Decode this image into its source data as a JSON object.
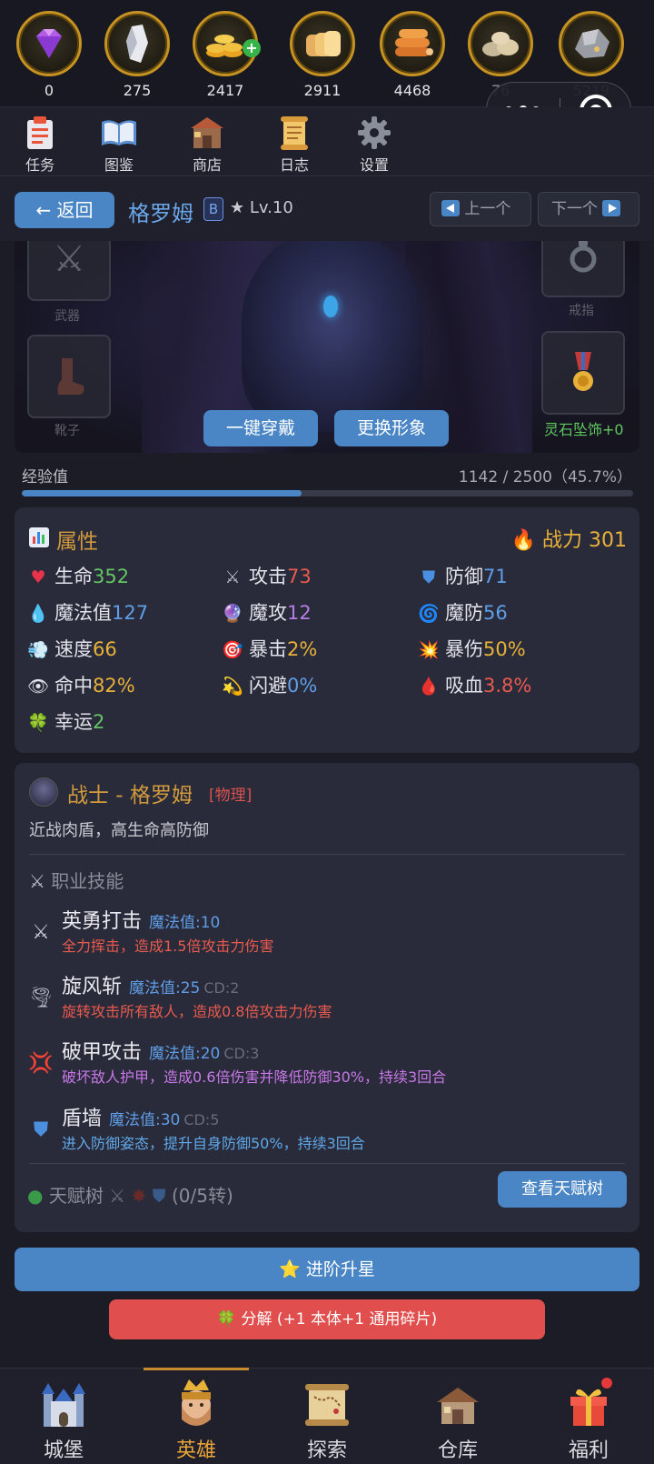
{
  "resources": [
    {
      "name": "diamond-icon",
      "value": "0"
    },
    {
      "name": "crystal-icon",
      "value": "275"
    },
    {
      "name": "gold-coins-icon",
      "value": "2417",
      "has_plus": true
    },
    {
      "name": "bread-icon",
      "value": "2911"
    },
    {
      "name": "wood-logs-icon",
      "value": "4468"
    },
    {
      "name": "stone-icon",
      "value": "76"
    },
    {
      "name": "ore-icon",
      "value": "5219"
    }
  ],
  "top_nav": [
    {
      "label": "任务",
      "icon": "clipboard-icon"
    },
    {
      "label": "图鉴",
      "icon": "book-icon"
    },
    {
      "label": "商店",
      "icon": "shop-icon"
    },
    {
      "label": "日志",
      "icon": "scroll-icon"
    },
    {
      "label": "设置",
      "icon": "gear-icon"
    }
  ],
  "header": {
    "back_label": "← 返回",
    "hero_name": "格罗姆",
    "rank": "B",
    "level": "★ Lv.10",
    "prev_label": "上一个",
    "next_label": "下一个"
  },
  "portrait": {
    "slot_weapon": "武器",
    "slot_boots": "靴子",
    "slot_ring": "戒指",
    "equip_all_label": "一键穿戴",
    "change_look_label": "更换形象",
    "lingshi_label": "灵石坠饰+0"
  },
  "exp": {
    "label": "经验值",
    "value_text": "1142 / 2500（45.7%）",
    "current": 1142,
    "max": 2500,
    "percent": 45.7
  },
  "attributes": {
    "title": "属性",
    "power_label": "战力 301",
    "stats": [
      {
        "icon": "heart-icon",
        "glyph": "♥",
        "icolor": "#e8334a",
        "label": "生命",
        "value": "352",
        "color": "#63c463"
      },
      {
        "icon": "swords-icon",
        "glyph": "⚔",
        "icolor": "#b9bcc8",
        "label": "攻击",
        "value": "73",
        "color": "#e85a4f"
      },
      {
        "icon": "shield-icon",
        "glyph": "⛊",
        "icolor": "#4a8fe0",
        "label": "防御",
        "value": "71",
        "color": "#5f9ee6"
      },
      {
        "icon": "drop-icon",
        "glyph": "💧",
        "icolor": "#3d9ae8",
        "label": "魔法值",
        "value": "127",
        "color": "#5f9ee6"
      },
      {
        "icon": "crystal-ball-icon",
        "glyph": "🔮",
        "icolor": "#b07ad8",
        "label": "魔攻",
        "value": "12",
        "color": "#b27ee2"
      },
      {
        "icon": "swirl-icon",
        "glyph": "🌀",
        "icolor": "#4aa8e8",
        "label": "魔防",
        "value": "56",
        "color": "#5f9ee6"
      },
      {
        "icon": "wind-icon",
        "glyph": "💨",
        "icolor": "#8ac4ee",
        "label": "速度",
        "value": "66",
        "color": "#e8b23a"
      },
      {
        "icon": "target-icon",
        "glyph": "🎯",
        "icolor": "#e84a4a",
        "label": "暴击",
        "value": "2%",
        "color": "#e8b23a"
      },
      {
        "icon": "explosion-icon",
        "glyph": "💥",
        "icolor": "#e85a3a",
        "label": "暴伤",
        "value": "50%",
        "color": "#e8b23a"
      },
      {
        "icon": "eye-icon",
        "glyph": "👁",
        "icolor": "#e2e2ea",
        "label": "命中",
        "value": "82%",
        "color": "#e8b23a"
      },
      {
        "icon": "dodge-icon",
        "glyph": "💫",
        "icolor": "#e8b23a",
        "label": "闪避",
        "value": "0%",
        "color": "#5f9ee6"
      },
      {
        "icon": "blood-drop-icon",
        "glyph": "🩸",
        "icolor": "#e83a4a",
        "label": "吸血",
        "value": "3.8%",
        "color": "#e85a4f"
      },
      {
        "icon": "clover-icon",
        "glyph": "🍀",
        "icolor": "#3fbf5a",
        "label": "幸运",
        "value": "2",
        "color": "#63c463"
      }
    ]
  },
  "class": {
    "name": "战士 - 格罗姆",
    "type": "[物理]",
    "desc": "近战肉盾，高生命高防御",
    "skills_title": "职业技能",
    "skills": [
      {
        "icon": "swords-icon",
        "glyph": "⚔",
        "icolor": "#c9ccd8",
        "name": "英勇打击",
        "cost": "魔法值:10",
        "cd": "",
        "desc": "全力挥击，造成1.5倍攻击力伤害",
        "dcolor": "#e85a4f"
      },
      {
        "icon": "tornado-icon",
        "glyph": "🌪",
        "icolor": "#b8bac6",
        "name": "旋风斩",
        "cost": "魔法值:25",
        "cd": "CD:2",
        "desc": "旋转攻击所有敌人，造成0.8倍攻击力伤害",
        "dcolor": "#e85a4f"
      },
      {
        "icon": "burst-icon",
        "glyph": "💢",
        "icolor": "#e84a4a",
        "name": "破甲攻击",
        "cost": "魔法值:20",
        "cd": "CD:3",
        "desc": "破坏敌人护甲，造成0.6倍伤害并降低防御30%，持续3回合",
        "dcolor": "#c878e8"
      },
      {
        "icon": "shield-icon",
        "glyph": "⛊",
        "icolor": "#4a8fe0",
        "name": "盾墙",
        "cost": "魔法值:30",
        "cd": "CD:5",
        "desc": "进入防御姿态，提升自身防御50%，持续3回合",
        "dcolor": "#5fa8e8"
      }
    ],
    "talent_label": "天赋树",
    "talent_progress": "(0/5转)",
    "talent_button": "查看天赋树"
  },
  "actions": {
    "advance_label": "⭐ 进阶升星",
    "decompose_label": "🍀 分解 (+1 本体+1 通用碎片)"
  },
  "bottom_nav": [
    {
      "label": "城堡",
      "icon": "castle-icon"
    },
    {
      "label": "英雄",
      "icon": "hero-icon",
      "active": true
    },
    {
      "label": "探索",
      "icon": "map-icon"
    },
    {
      "label": "仓库",
      "icon": "warehouse-icon"
    },
    {
      "label": "福利",
      "icon": "gift-icon"
    }
  ]
}
